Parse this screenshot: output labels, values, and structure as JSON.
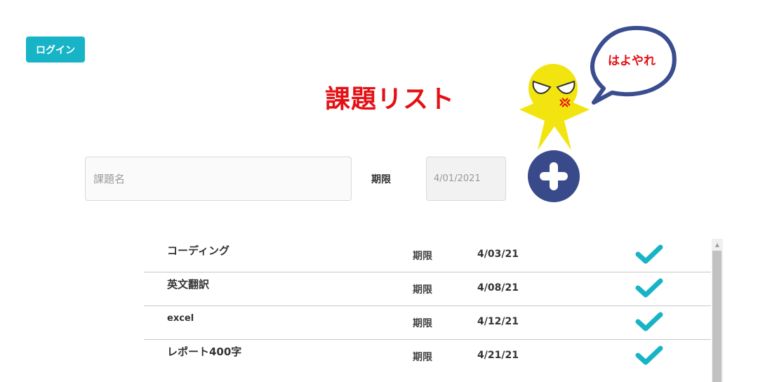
{
  "header": {
    "login_label": "ログイン"
  },
  "page": {
    "title": "課題リスト"
  },
  "mascot": {
    "speech": "はよやれ"
  },
  "form": {
    "task_placeholder": "課題名",
    "deadline_label": "期限",
    "date_value": "4/01/2021"
  },
  "tasks": [
    {
      "name": "コーディング",
      "deadline_label": "期限",
      "date": "4/03/21"
    },
    {
      "name": "英文翻訳",
      "deadline_label": "期限",
      "date": "4/08/21"
    },
    {
      "name": "excel",
      "deadline_label": "期限",
      "date": "4/12/21"
    },
    {
      "name": "レポート400字",
      "deadline_label": "期限",
      "date": "4/21/21"
    }
  ],
  "colors": {
    "accent": "#17b3c6",
    "title": "#e51014",
    "add_button": "#394a8a",
    "mascot_body": "#f2e40e",
    "speech_border": "#3a4d8f"
  },
  "icons": {
    "add": "plus-icon",
    "complete": "check-icon",
    "scroll_up": "scroll-up-arrow-icon"
  }
}
